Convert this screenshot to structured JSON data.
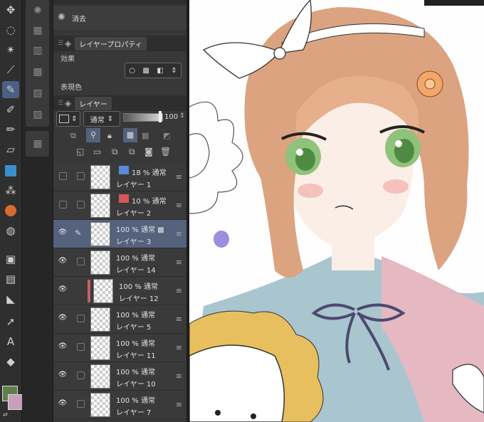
{
  "tools": [
    "lasso-icon",
    "magic-wand-icon",
    "eyedropper-icon",
    "pen-icon",
    "pencil-icon",
    "brush-icon",
    "eraser-icon",
    "texture-icon",
    "spray-icon",
    "fill-icon",
    "blend-icon",
    "gradient-icon",
    "frame-icon",
    "ruler-icon",
    "operation-icon",
    "text-icon",
    "correction-icon"
  ],
  "panel": {
    "history_item": "消去",
    "properties_title": "レイヤープロパティ",
    "effect_label": "効果",
    "expression_label": "表現色",
    "layer_tab": "レイヤー",
    "blend_mode": "通常",
    "opacity_value": "100"
  },
  "layers": [
    {
      "opacity": "18 %",
      "mode": "通常",
      "name": "レイヤー 1",
      "visible": false,
      "selected": false
    },
    {
      "opacity": "10 %",
      "mode": "通常",
      "name": "レイヤー 2",
      "visible": false,
      "selected": false
    },
    {
      "opacity": "100 %",
      "mode": "通常",
      "name": "レイヤー 3",
      "visible": true,
      "selected": true
    },
    {
      "opacity": "100 %",
      "mode": "通常",
      "name": "レイヤー 14",
      "visible": true,
      "selected": false
    },
    {
      "opacity": "100 %",
      "mode": "通常",
      "name": "レイヤー 12",
      "visible": true,
      "selected": false
    },
    {
      "opacity": "100 %",
      "mode": "通常",
      "name": "レイヤー 5",
      "visible": true,
      "selected": false
    },
    {
      "opacity": "100 %",
      "mode": "通常",
      "name": "レイヤー 11",
      "visible": true,
      "selected": false
    },
    {
      "opacity": "100 %",
      "mode": "通常",
      "name": "レイヤー 10",
      "visible": true,
      "selected": false
    },
    {
      "opacity": "100 %",
      "mode": "通常",
      "name": "レイヤー 7",
      "visible": true,
      "selected": false
    }
  ],
  "colors": {
    "main": "#5f7f4a",
    "sub": "#c5a0b8",
    "selected_row": "#55627e",
    "active_tool": "#4d5f86"
  }
}
